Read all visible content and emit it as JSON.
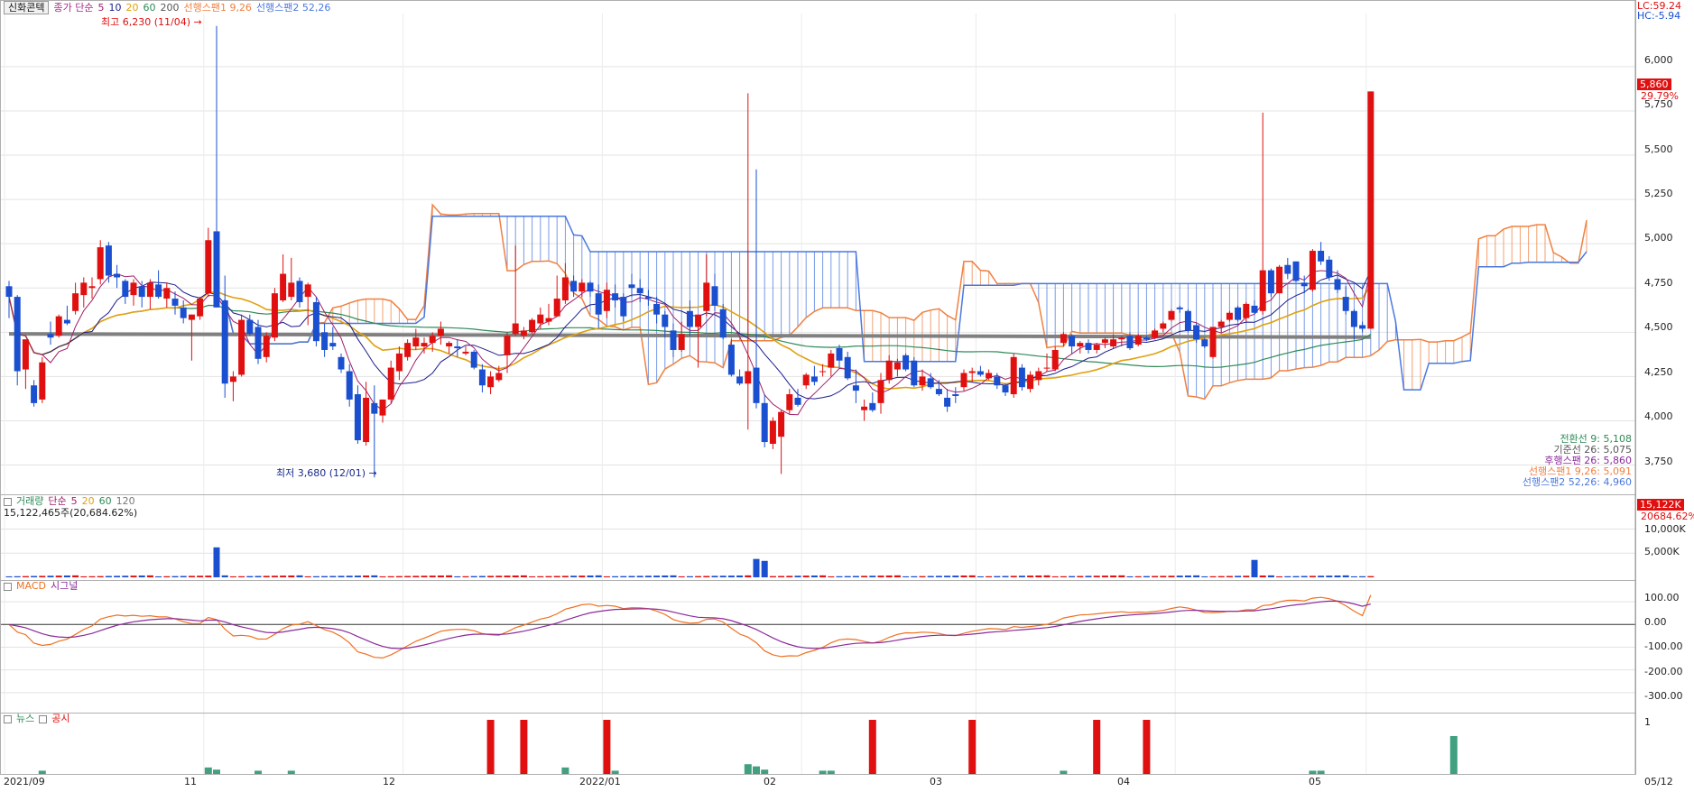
{
  "header": {
    "stock_name": "신화콘텍",
    "price_label": "종가 단순",
    "ma_periods": [
      "5",
      "10",
      "20",
      "60",
      "200"
    ],
    "span1_label": "선행스팬1 9,26",
    "span2_label": "선행스팬2 52,26",
    "lc_label": "LC:59.24",
    "hc_label": "HC:-5.94"
  },
  "colors": {
    "up": "#e01010",
    "down": "#1a4fd0",
    "span1": "#f08040",
    "span2": "#4a78e0",
    "ma5": "#a0206a",
    "ma10": "#1c1c8c",
    "ma20": "#e0a010",
    "ma60": "#2e8b57",
    "ma200": "#808080",
    "macd": "#f07020",
    "signal": "#8a2a9a",
    "news": "#40a080",
    "disclosure": "#e01010"
  },
  "annotations": {
    "high": "최고 6,230 (11/04)",
    "low": "최저 3,680 (12/01)"
  },
  "current_price": {
    "value": "5,860",
    "change": "29.79%"
  },
  "ichimoku_legend": [
    "전환선 9: 5,108",
    "기준선 26: 5,075",
    "후행스팬 26: 5,860",
    "선행스팬1 9,26: 5,091",
    "선행스팬2 52,26: 4,960"
  ],
  "volume_panel": {
    "title": "거래량",
    "ma_label": "단순",
    "ma_periods": [
      "5",
      "20",
      "60",
      "120"
    ],
    "summary": "15,122,465주(20,684.62%)",
    "current_value": "15,122K",
    "current_pct": "20684.62%",
    "axis": [
      "10,000K",
      "5,000K"
    ]
  },
  "macd_panel": {
    "macd_label": "MACD",
    "signal_label": "시그널",
    "axis": [
      "100.00",
      "0.00",
      "-100.00",
      "-200.00",
      "-300.00"
    ]
  },
  "news_panel": {
    "news_label": "뉴스",
    "disclosure_label": "공시",
    "axis_max": "1"
  },
  "price_axis": [
    "6,000",
    "5,750",
    "5,500",
    "5,250",
    "5,000",
    "4,750",
    "4,500",
    "4,250",
    "4,000",
    "3,750"
  ],
  "x_axis": [
    "2021/09",
    "11",
    "12",
    "2022/01",
    "02",
    "03",
    "04",
    "05",
    "05/12"
  ],
  "chart_data": {
    "type": "candlestick",
    "ylim": [
      3600,
      6300
    ],
    "candles": [
      [
        4760,
        4790,
        4580,
        4700
      ],
      [
        4700,
        4710,
        4200,
        4280
      ],
      [
        4290,
        4430,
        4180,
        4460
      ],
      [
        4200,
        4230,
        4080,
        4100
      ],
      [
        4120,
        4360,
        4100,
        4330
      ],
      [
        4490,
        4560,
        4430,
        4470
      ],
      [
        4480,
        4600,
        4470,
        4590
      ],
      [
        4570,
        4650,
        4540,
        4550
      ],
      [
        4620,
        4780,
        4600,
        4720
      ],
      [
        4710,
        4810,
        4640,
        4780
      ],
      [
        4750,
        4810,
        4690,
        4760
      ],
      [
        4800,
        5020,
        4770,
        4980
      ],
      [
        4990,
        5010,
        4780,
        4820
      ],
      [
        4830,
        4880,
        4750,
        4810
      ],
      [
        4790,
        4800,
        4660,
        4700
      ],
      [
        4710,
        4800,
        4650,
        4780
      ],
      [
        4760,
        4790,
        4640,
        4700
      ],
      [
        4700,
        4800,
        4630,
        4780
      ],
      [
        4770,
        4850,
        4690,
        4700
      ],
      [
        4690,
        4780,
        4640,
        4750
      ],
      [
        4690,
        4730,
        4600,
        4650
      ],
      [
        4640,
        4680,
        4550,
        4580
      ],
      [
        4570,
        4600,
        4340,
        4600
      ],
      [
        4590,
        4700,
        4570,
        4690
      ],
      [
        4720,
        5090,
        4700,
        5020
      ],
      [
        5070,
        6230,
        4640,
        4640
      ],
      [
        4680,
        4820,
        4130,
        4210
      ],
      [
        4220,
        4280,
        4110,
        4250
      ],
      [
        4260,
        4600,
        4250,
        4570
      ],
      [
        4570,
        4600,
        4480,
        4490
      ],
      [
        4530,
        4570,
        4320,
        4350
      ],
      [
        4360,
        4500,
        4330,
        4480
      ],
      [
        4470,
        4750,
        4450,
        4720
      ],
      [
        4680,
        4940,
        4670,
        4830
      ],
      [
        4700,
        4920,
        4680,
        4780
      ],
      [
        4790,
        4810,
        4640,
        4670
      ],
      [
        4700,
        4780,
        4540,
        4770
      ],
      [
        4670,
        4700,
        4420,
        4450
      ],
      [
        4500,
        4550,
        4360,
        4400
      ],
      [
        4440,
        4530,
        4400,
        4420
      ],
      [
        4360,
        4380,
        4270,
        4290
      ],
      [
        4280,
        4320,
        4080,
        4120
      ],
      [
        4150,
        4200,
        3870,
        3890
      ],
      [
        3880,
        4220,
        3860,
        4130
      ],
      [
        4100,
        4200,
        3680,
        4040
      ],
      [
        4030,
        4120,
        3990,
        4120
      ],
      [
        4120,
        4340,
        4100,
        4300
      ],
      [
        4280,
        4420,
        4230,
        4380
      ],
      [
        4360,
        4460,
        4340,
        4440
      ],
      [
        4420,
        4520,
        4400,
        4470
      ],
      [
        4420,
        4470,
        4380,
        4440
      ],
      [
        4440,
        4500,
        4390,
        4480
      ],
      [
        4480,
        4560,
        4430,
        4520
      ],
      [
        4420,
        4450,
        4380,
        4440
      ],
      [
        4420,
        4460,
        4360,
        4410
      ],
      [
        4380,
        4420,
        4370,
        4390
      ],
      [
        4390,
        4400,
        4290,
        4300
      ],
      [
        4290,
        4320,
        4160,
        4200
      ],
      [
        4190,
        4280,
        4150,
        4250
      ],
      [
        4230,
        4310,
        4220,
        4270
      ],
      [
        4370,
        4500,
        4270,
        4480
      ],
      [
        4490,
        4990,
        4480,
        4550
      ],
      [
        4480,
        4530,
        4460,
        4510
      ],
      [
        4500,
        4580,
        4490,
        4570
      ],
      [
        4550,
        4640,
        4520,
        4600
      ],
      [
        4560,
        4660,
        4540,
        4580
      ],
      [
        4590,
        4820,
        4590,
        4690
      ],
      [
        4680,
        4890,
        4660,
        4810
      ],
      [
        4790,
        4820,
        4700,
        4730
      ],
      [
        4730,
        4800,
        4700,
        4780
      ],
      [
        4780,
        4790,
        4700,
        4730
      ],
      [
        4720,
        4770,
        4520,
        4600
      ],
      [
        4620,
        4780,
        4580,
        4740
      ],
      [
        4720,
        4770,
        4640,
        4680
      ],
      [
        4700,
        4720,
        4560,
        4590
      ],
      [
        4770,
        4830,
        4700,
        4750
      ],
      [
        4750,
        4800,
        4670,
        4720
      ],
      [
        4700,
        4740,
        4650,
        4690
      ],
      [
        4660,
        4700,
        4550,
        4600
      ],
      [
        4600,
        4620,
        4470,
        4530
      ],
      [
        4510,
        4550,
        4360,
        4400
      ],
      [
        4400,
        4560,
        4390,
        4490
      ],
      [
        4620,
        4680,
        4480,
        4530
      ],
      [
        4530,
        4590,
        4300,
        4600
      ],
      [
        4620,
        4940,
        4590,
        4780
      ],
      [
        4760,
        4830,
        4620,
        4650
      ],
      [
        4630,
        4660,
        4460,
        4470
      ],
      [
        4430,
        4460,
        4250,
        4260
      ],
      [
        4250,
        4290,
        4200,
        4210
      ],
      [
        4210,
        5850,
        3950,
        4280
      ],
      [
        4300,
        5420,
        4070,
        4100
      ],
      [
        4100,
        4150,
        3850,
        3880
      ],
      [
        3870,
        4020,
        3840,
        4000
      ],
      [
        3910,
        4060,
        3700,
        4050
      ],
      [
        4060,
        4180,
        4040,
        4150
      ],
      [
        4130,
        4180,
        4080,
        4090
      ],
      [
        4200,
        4270,
        4180,
        4260
      ],
      [
        4250,
        4310,
        4200,
        4220
      ],
      [
        4280,
        4320,
        4250,
        4280
      ],
      [
        4300,
        4400,
        4250,
        4380
      ],
      [
        4410,
        4430,
        4300,
        4340
      ],
      [
        4360,
        4390,
        4230,
        4240
      ],
      [
        4200,
        4290,
        4100,
        4170
      ],
      [
        4060,
        4120,
        4000,
        4080
      ],
      [
        4100,
        4160,
        4050,
        4060
      ],
      [
        4100,
        4270,
        4040,
        4230
      ],
      [
        4230,
        4370,
        4210,
        4340
      ],
      [
        4290,
        4350,
        4250,
        4330
      ],
      [
        4370,
        4380,
        4280,
        4290
      ],
      [
        4340,
        4360,
        4190,
        4200
      ],
      [
        4200,
        4290,
        4170,
        4250
      ],
      [
        4240,
        4270,
        4180,
        4190
      ],
      [
        4180,
        4230,
        4140,
        4150
      ],
      [
        4130,
        4180,
        4050,
        4080
      ],
      [
        4150,
        4190,
        4100,
        4140
      ],
      [
        4190,
        4290,
        4170,
        4270
      ],
      [
        4270,
        4300,
        4220,
        4280
      ],
      [
        4280,
        4310,
        4250,
        4260
      ],
      [
        4240,
        4290,
        4230,
        4270
      ],
      [
        4250,
        4270,
        4180,
        4200
      ],
      [
        4200,
        4210,
        4140,
        4160
      ],
      [
        4150,
        4380,
        4130,
        4360
      ],
      [
        4300,
        4320,
        4170,
        4190
      ],
      [
        4180,
        4280,
        4160,
        4260
      ],
      [
        4230,
        4300,
        4200,
        4280
      ],
      [
        4300,
        4380,
        4280,
        4300
      ],
      [
        4290,
        4420,
        4280,
        4400
      ],
      [
        4440,
        4500,
        4420,
        4490
      ],
      [
        4480,
        4490,
        4380,
        4420
      ],
      [
        4420,
        4450,
        4380,
        4440
      ],
      [
        4440,
        4460,
        4380,
        4400
      ],
      [
        4400,
        4440,
        4380,
        4430
      ],
      [
        4440,
        4470,
        4410,
        4460
      ],
      [
        4420,
        4490,
        4410,
        4460
      ],
      [
        4460,
        4480,
        4420,
        4470
      ],
      [
        4480,
        4500,
        4400,
        4410
      ],
      [
        4430,
        4490,
        4420,
        4480
      ],
      [
        4470,
        4480,
        4450,
        4460
      ],
      [
        4470,
        4520,
        4460,
        4510
      ],
      [
        4520,
        4560,
        4500,
        4550
      ],
      [
        4570,
        4630,
        4560,
        4620
      ],
      [
        4640,
        4650,
        4610,
        4630
      ],
      [
        4620,
        4630,
        4500,
        4510
      ],
      [
        4540,
        4550,
        4440,
        4460
      ],
      [
        4460,
        4470,
        4410,
        4420
      ],
      [
        4360,
        4530,
        4350,
        4530
      ],
      [
        4530,
        4570,
        4500,
        4560
      ],
      [
        4570,
        4620,
        4560,
        4610
      ],
      [
        4640,
        4650,
        4560,
        4570
      ],
      [
        4580,
        4670,
        4560,
        4660
      ],
      [
        4650,
        4680,
        4600,
        4610
      ],
      [
        4620,
        5740,
        4600,
        4850
      ],
      [
        4850,
        4860,
        4700,
        4720
      ],
      [
        4720,
        4880,
        4720,
        4870
      ],
      [
        4880,
        4920,
        4800,
        4830
      ],
      [
        4900,
        4900,
        4780,
        4790
      ],
      [
        4780,
        4820,
        4720,
        4760
      ],
      [
        4740,
        4970,
        4730,
        4960
      ],
      [
        4960,
        5010,
        4880,
        4900
      ],
      [
        4910,
        4930,
        4790,
        4810
      ],
      [
        4800,
        4850,
        4720,
        4740
      ],
      [
        4700,
        4760,
        4600,
        4620
      ],
      [
        4620,
        4630,
        4460,
        4530
      ],
      [
        4540,
        4560,
        4500,
        4520
      ],
      [
        4520,
        5860,
        4520,
        5860
      ]
    ],
    "volume_spikes": [
      {
        "index": 25,
        "value": 6200
      },
      {
        "index": 90,
        "value": 3800
      },
      {
        "index": 91,
        "value": 3400
      },
      {
        "index": 150,
        "value": 3600
      },
      {
        "index": 174,
        "value": 15122
      }
    ],
    "volume_ylim": [
      0,
      15500
    ],
    "macd_ylim": [
      -380,
      160
    ],
    "news_events": [
      {
        "index": 4,
        "type": "news",
        "value": 0.06
      },
      {
        "index": 24,
        "type": "news",
        "value": 0.12
      },
      {
        "index": 25,
        "type": "news",
        "value": 0.08
      },
      {
        "index": 30,
        "type": "news",
        "value": 0.06
      },
      {
        "index": 34,
        "type": "news",
        "value": 0.06
      },
      {
        "index": 58,
        "type": "disclosure",
        "value": 1
      },
      {
        "index": 62,
        "type": "disclosure",
        "value": 1
      },
      {
        "index": 67,
        "type": "news",
        "value": 0.12
      },
      {
        "index": 72,
        "type": "disclosure",
        "value": 1
      },
      {
        "index": 73,
        "type": "news",
        "value": 0.06
      },
      {
        "index": 89,
        "type": "news",
        "value": 0.18
      },
      {
        "index": 90,
        "type": "news",
        "value": 0.14
      },
      {
        "index": 91,
        "type": "news",
        "value": 0.08
      },
      {
        "index": 98,
        "type": "news",
        "value": 0.06
      },
      {
        "index": 99,
        "type": "news",
        "value": 0.06
      },
      {
        "index": 104,
        "type": "disclosure",
        "value": 1
      },
      {
        "index": 116,
        "type": "disclosure",
        "value": 1
      },
      {
        "index": 127,
        "type": "news",
        "value": 0.06
      },
      {
        "index": 131,
        "type": "disclosure",
        "value": 1
      },
      {
        "index": 137,
        "type": "disclosure",
        "value": 1
      },
      {
        "index": 157,
        "type": "news",
        "value": 0.06
      },
      {
        "index": 158,
        "type": "news",
        "value": 0.06
      },
      {
        "index": 174,
        "type": "news",
        "value": 0.7
      }
    ],
    "x_label_indices": [
      0,
      24,
      48,
      72,
      96,
      117,
      141,
      164
    ]
  }
}
